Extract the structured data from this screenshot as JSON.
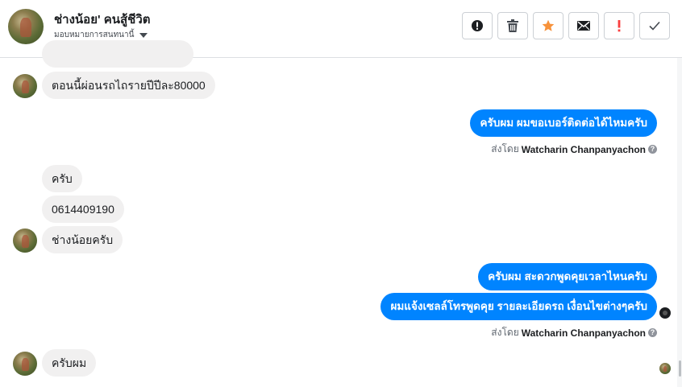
{
  "header": {
    "name": "ช่างน้อย' คนสู้ชีวิต",
    "subtitle": "มอบหมายการสนทนานี้",
    "actions": [
      {
        "icon": "alert-circle-icon"
      },
      {
        "icon": "trash-icon"
      },
      {
        "icon": "star-icon",
        "color": "#f7923b"
      },
      {
        "icon": "mail-icon"
      },
      {
        "icon": "exclamation-icon",
        "color": "#fa3e3e"
      },
      {
        "icon": "check-icon"
      }
    ]
  },
  "messages": [
    {
      "from": "customer",
      "text": "ตอนนี้ผ่อนรถไถรายปีปีละ80000"
    },
    {
      "from": "page",
      "text": "ครับผม ผมขอเบอร์ติดต่อได้ไหมครับ"
    },
    {
      "from": "customer",
      "text": "ครับ"
    },
    {
      "from": "customer",
      "text": "0614409190"
    },
    {
      "from": "customer",
      "text": "ช่างน้อยครับ"
    },
    {
      "from": "page",
      "text": "ครับผม สะดวกพูดคุยเวลาไหนครับ"
    },
    {
      "from": "page",
      "text": "ผมแจ้งเซลล์โทรพูดคุย รายละเอียดรถ เงื่อนไขต่างๆครับ"
    },
    {
      "from": "customer",
      "text": "ครับผม"
    }
  ],
  "sent_by": {
    "prefix": "ส่งโดย",
    "agent": "Watcharin Chanpanyachon",
    "help": "?"
  },
  "colors": {
    "outgoing_bubble": "#0084ff",
    "incoming_bubble": "#f1f0f0"
  }
}
